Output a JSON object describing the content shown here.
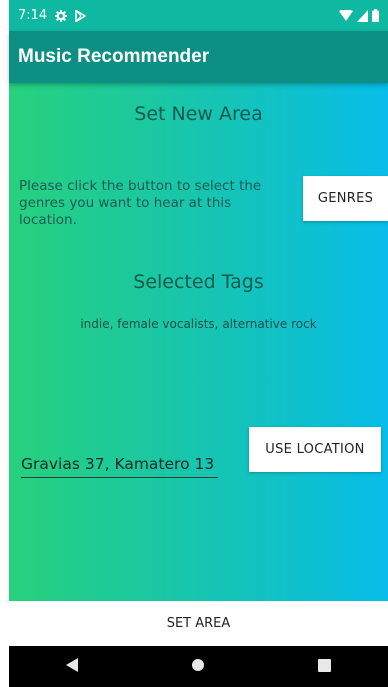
{
  "status_bar": {
    "time": "7:14",
    "icons": [
      "settings-icon",
      "play-store-icon",
      "wifi-icon",
      "signal-icon",
      "battery-icon"
    ]
  },
  "app_bar": {
    "title": "Music Recommender",
    "color": "#0d8f84"
  },
  "main": {
    "title": "Set New Area",
    "instruction": "Please click the button to select the genres you want to hear at this location.",
    "genres_button": "GENRES",
    "selected_tags_title": "Selected Tags",
    "selected_tags": "indie, female vocalists, alternative rock",
    "location_value": "Gravias 37, Kamatero 13",
    "use_location_button": "USE LOCATION",
    "gradient_colors": [
      "#26d17c",
      "#07bde9"
    ]
  },
  "bottom": {
    "set_area_label": "SET AREA"
  },
  "nav": {
    "icons": [
      "back-icon",
      "home-icon",
      "recents-icon"
    ]
  }
}
